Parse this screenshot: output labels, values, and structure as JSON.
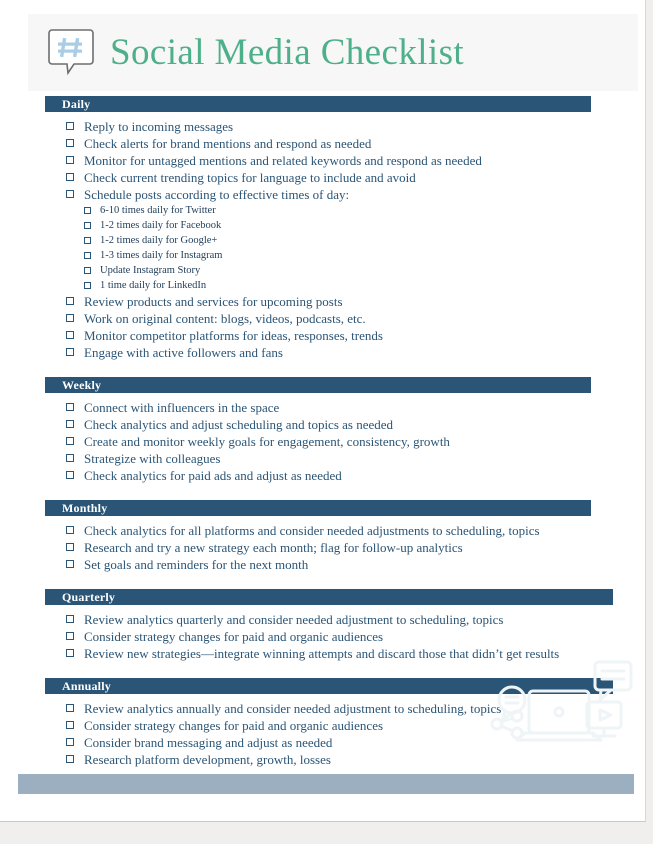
{
  "document": {
    "title": "Social Media Checklist",
    "brand_icon": "hashtag-speech-bubble-icon",
    "title_color": "#4EB08B",
    "section_bar_color": "#2B5576",
    "footer_bar_color": "#9BAFC0",
    "text_color": "#2B5576"
  },
  "sections": [
    {
      "title": "Daily",
      "items": [
        {
          "label": "Reply to incoming messages",
          "sub": []
        },
        {
          "label": "Check alerts for brand mentions and respond as needed",
          "sub": []
        },
        {
          "label": "Monitor for untagged mentions and related keywords and respond as needed",
          "sub": []
        },
        {
          "label": "Check current trending topics for language to include and avoid",
          "sub": []
        },
        {
          "label": "Schedule posts according to effective times of day:",
          "sub": [
            "6-10 times daily for Twitter",
            "1-2 times daily for Facebook",
            "1-2 times daily for Google+",
            "1-3 times daily for Instagram",
            "Update Instagram Story",
            "1 time daily for LinkedIn"
          ]
        },
        {
          "label": "Review products and services for upcoming posts",
          "sub": []
        },
        {
          "label": "Work on original content: blogs, videos, podcasts, etc.",
          "sub": []
        },
        {
          "label": "Monitor competitor platforms for ideas, responses, trends",
          "sub": []
        },
        {
          "label": "Engage with active followers and fans",
          "sub": []
        }
      ]
    },
    {
      "title": "Weekly",
      "items": [
        {
          "label": "Connect with influencers in the space",
          "sub": []
        },
        {
          "label": "Check analytics and adjust scheduling and topics as needed",
          "sub": []
        },
        {
          "label": "Create and monitor weekly goals for engagement, consistency, growth",
          "sub": []
        },
        {
          "label": "Strategize with colleagues",
          "sub": []
        },
        {
          "label": "Check analytics for paid ads and adjust as needed",
          "sub": []
        }
      ]
    },
    {
      "title": "Monthly",
      "items": [
        {
          "label": "Check analytics for all platforms and consider needed adjustments to scheduling, topics",
          "sub": []
        },
        {
          "label": "Research and try a new strategy each month; flag for follow-up analytics",
          "sub": []
        },
        {
          "label": "Set goals and reminders for the next month",
          "sub": []
        }
      ]
    },
    {
      "title": "Quarterly",
      "items": [
        {
          "label": "Review analytics quarterly and consider needed adjustment to scheduling, topics",
          "sub": []
        },
        {
          "label": "Consider strategy changes for paid and organic audiences",
          "sub": []
        },
        {
          "label": "Review new strategies—integrate winning attempts and discard those that didn’t get results",
          "sub": []
        }
      ]
    },
    {
      "title": "Annually",
      "items": [
        {
          "label": "Review analytics annually and consider needed adjustment to scheduling, topics",
          "sub": []
        },
        {
          "label": "Consider strategy changes for paid and organic audiences",
          "sub": []
        },
        {
          "label": "Consider brand messaging and adjust as needed",
          "sub": []
        },
        {
          "label": "Research platform development, growth, losses",
          "sub": []
        }
      ]
    }
  ],
  "watermark": {
    "name": "social-media-devices-watermark"
  }
}
